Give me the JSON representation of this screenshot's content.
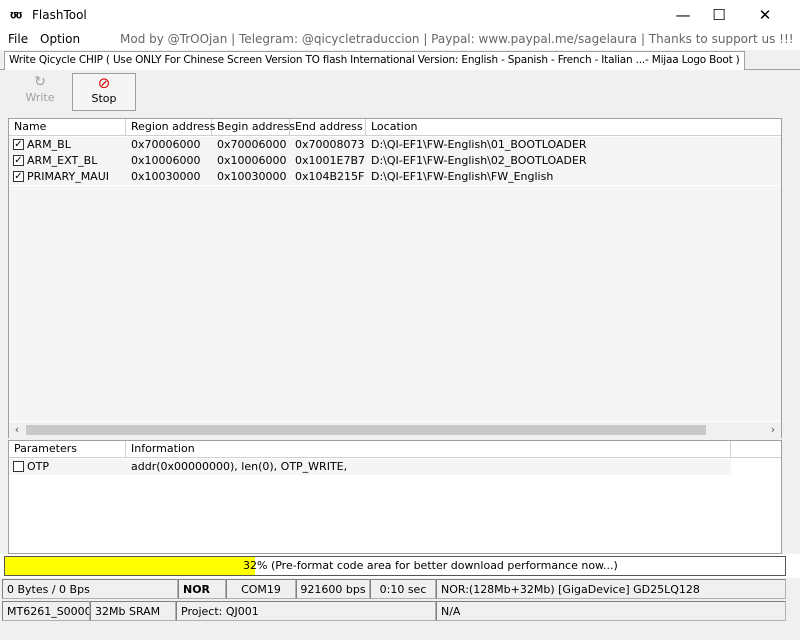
{
  "window": {
    "app_icon": "ʊʊ",
    "title": "FlashTool",
    "minimize": "—",
    "maximize": "☐",
    "close": "✕"
  },
  "menu": {
    "file": "File",
    "option": "Option",
    "credits": "Mod by @TrOOjan | Telegram: @qicycletraduccion |  Paypal:   www.paypal.me/sagelaura   | Thanks to support us !!!"
  },
  "tab": {
    "label": "Write Qicycle CHIP ( Use ONLY For Chinese Screen Version TO flash International Version: English - Spanish - French - Italian ...- Mijaa Logo Boot )"
  },
  "toolbar": {
    "write_icon": "↻",
    "write_label": "Write",
    "stop_icon": "⊘",
    "stop_label": "Stop"
  },
  "regions": {
    "columns": [
      "Name",
      "Region address",
      "Begin address",
      "End address",
      "Location"
    ],
    "rows": [
      {
        "checked": "✓",
        "name": "ARM_BL",
        "region": "0x70006000",
        "begin": "0x70006000",
        "end": "0x70008073",
        "location": "D:\\QI-EF1\\FW-English\\01_BOOTLOADER"
      },
      {
        "checked": "✓",
        "name": "ARM_EXT_BL",
        "region": "0x10006000",
        "begin": "0x10006000",
        "end": "0x1001E7B7",
        "location": "D:\\QI-EF1\\FW-English\\02_BOOTLOADER"
      },
      {
        "checked": "✓",
        "name": "PRIMARY_MAUI",
        "region": "0x10030000",
        "begin": "0x10030000",
        "end": "0x104B215F",
        "location": "D:\\QI-EF1\\FW-English\\FW_English"
      }
    ],
    "scroll_left": "‹",
    "scroll_right": "›"
  },
  "params": {
    "columns": [
      "Parameters",
      "Information"
    ],
    "rows": [
      {
        "checked": "",
        "name": "OTP",
        "info": "addr(0x00000000), len(0), OTP_WRITE,"
      }
    ]
  },
  "progress": {
    "percent": 32,
    "text": "32% (Pre-format code area for better download performance now...)",
    "color": "#ffff00"
  },
  "status": {
    "bytes": "0 Bytes / 0 Bps",
    "flash_type": "NOR",
    "port": "COM19",
    "baud": "921600 bps",
    "time": "0:10 sec",
    "nor_info": "NOR:(128Mb+32Mb) [GigaDevice] GD25LQ128",
    "chip": "MT6261_S0000",
    "sram": "32Mb SRAM",
    "project": "Project: QJ001",
    "na": "N/A"
  }
}
